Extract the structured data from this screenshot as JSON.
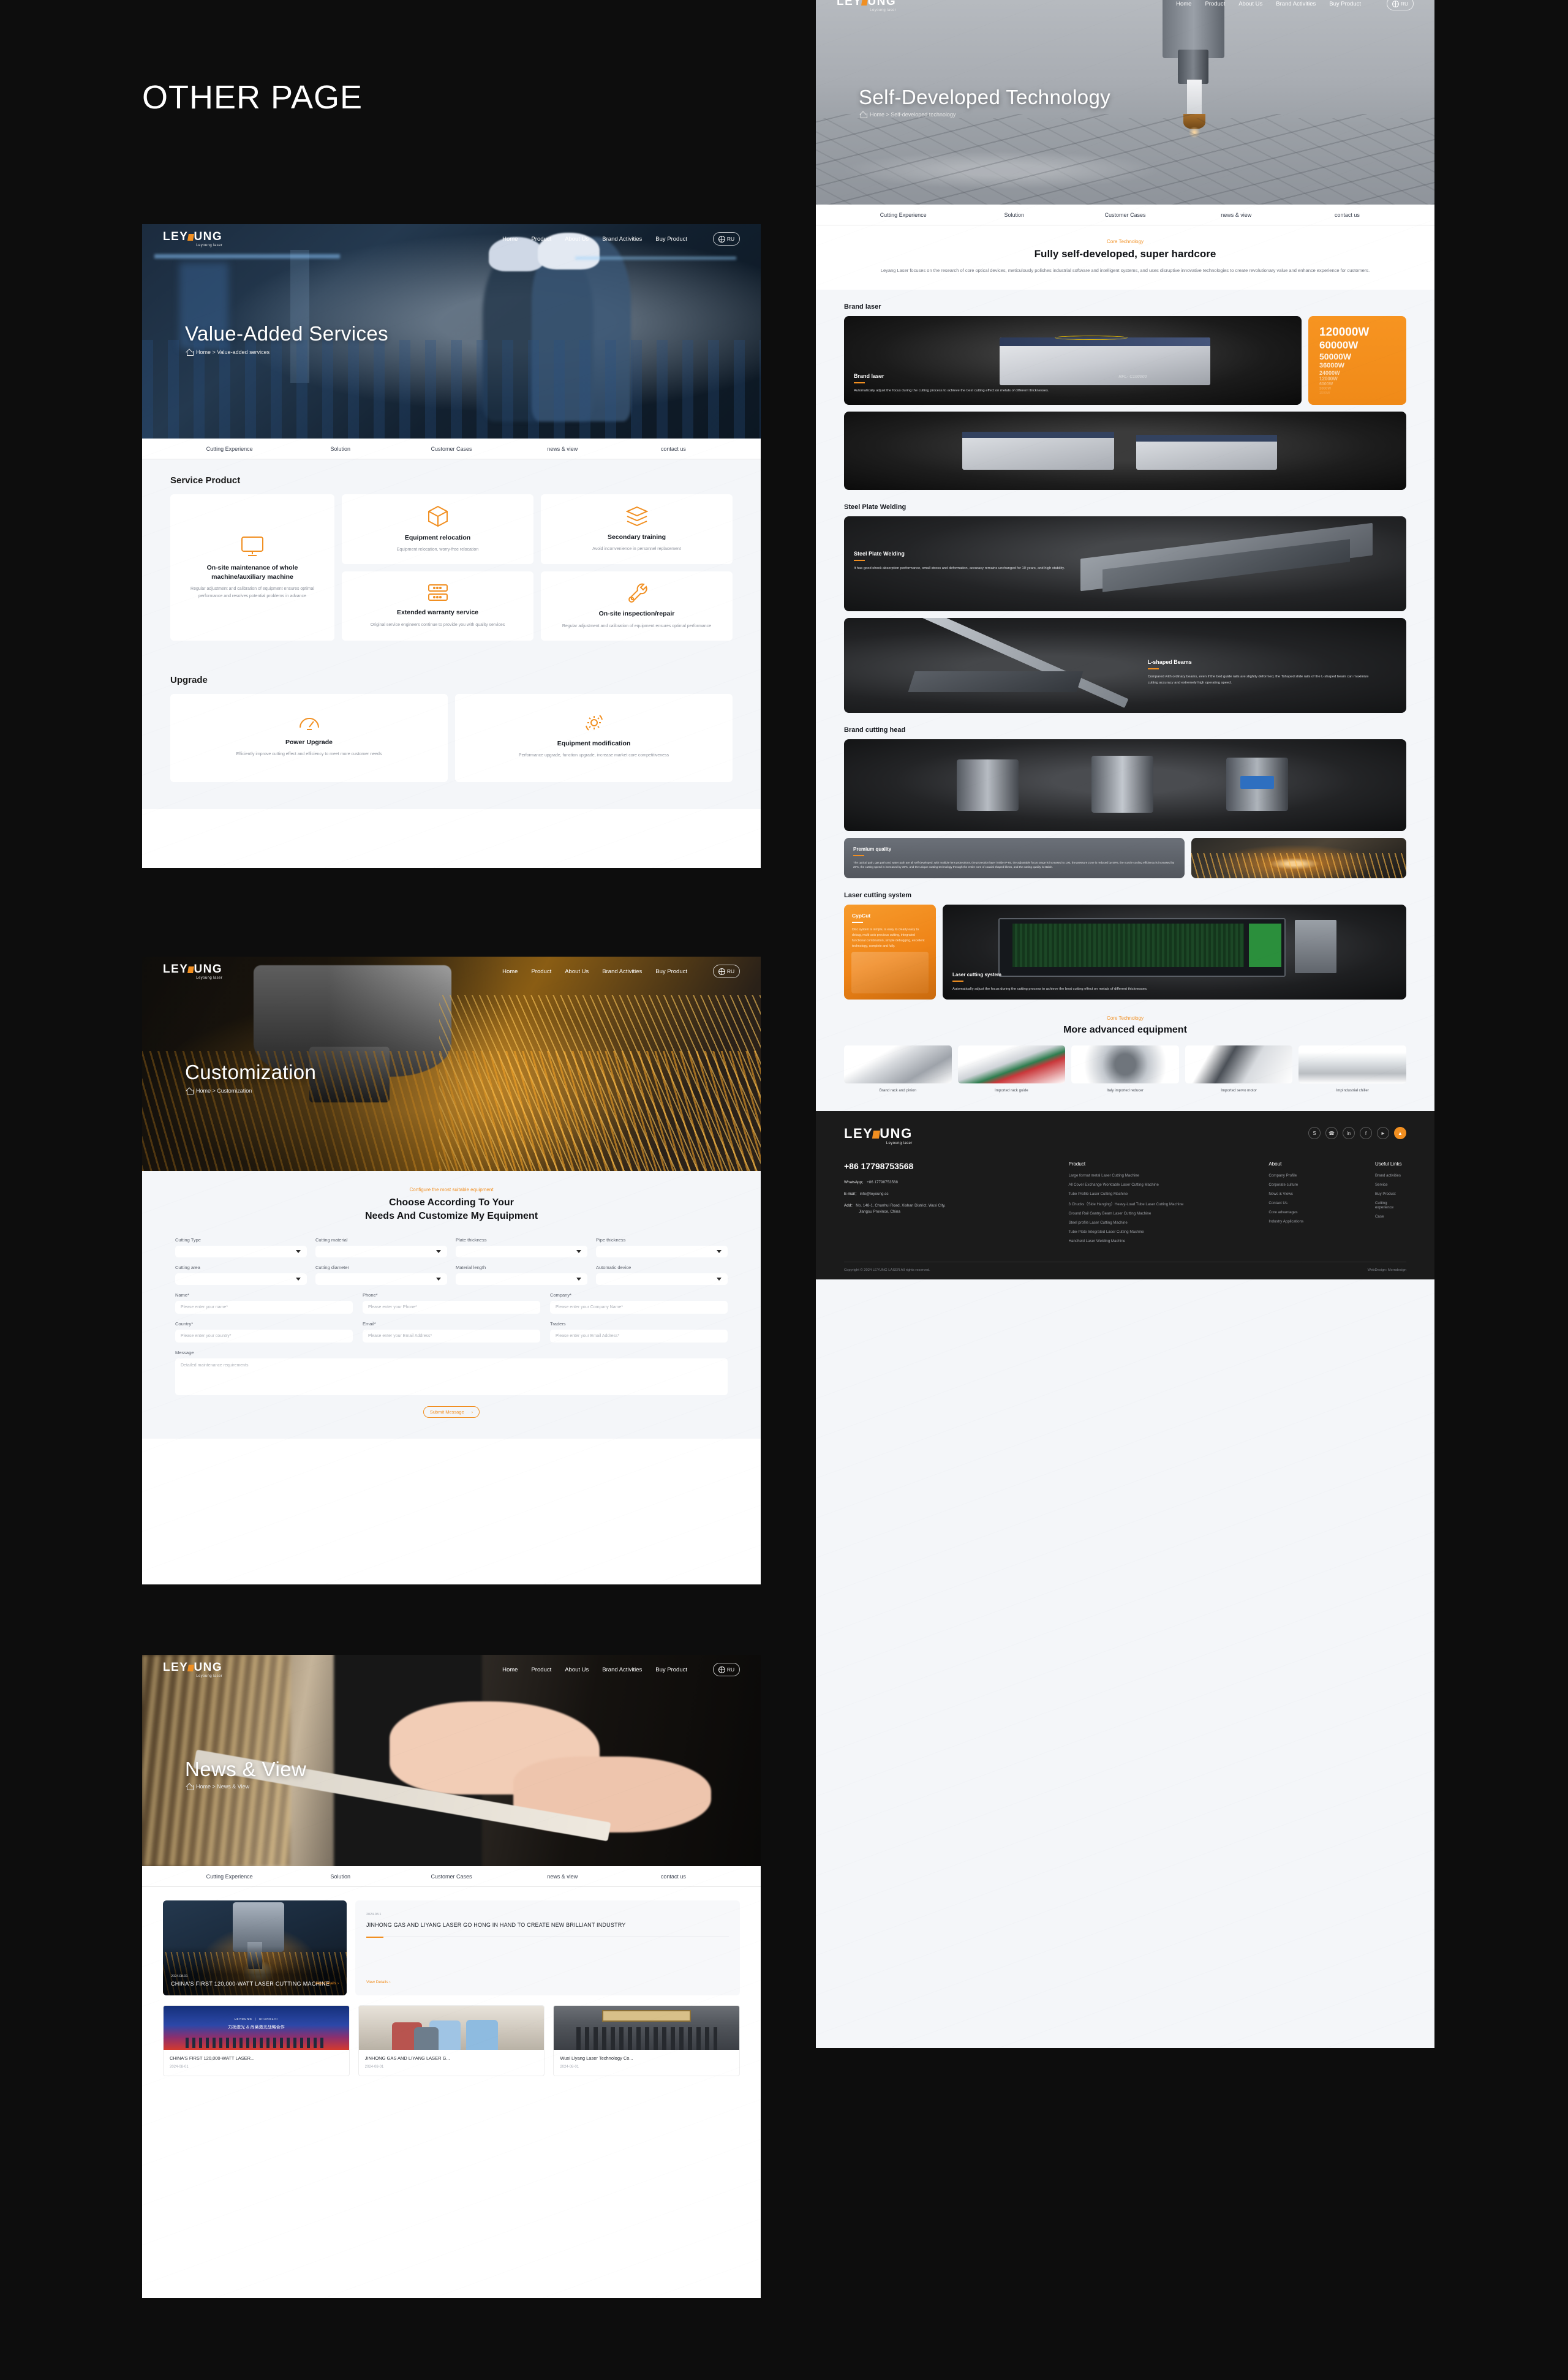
{
  "board": {
    "title": "OTHER PAGE"
  },
  "brand": {
    "name": "LEYOUNG",
    "tagline": "Leyoung laser",
    "accent": "#f18f21"
  },
  "nav": {
    "links": [
      "Home",
      "Product",
      "About Us",
      "Brand Activities",
      "Buy Product"
    ],
    "lang": "RU"
  },
  "subnav": [
    "Cutting Experience",
    "Solution",
    "Customer Cases",
    "news & view",
    "contact us"
  ],
  "pages": {
    "value_added": {
      "hero_title": "Value-Added Services",
      "breadcrumb": "Home > Value-added services",
      "service_section_title": "Service Product",
      "service_main": {
        "icon": "monitor-icon",
        "title": "On-site maintenance of whole machine/auxiliary machine",
        "desc": "Regular adjustment and calibration of equipment ensures optimal performance and resolves potential problems in advance"
      },
      "service_cards": [
        {
          "icon": "box-icon",
          "title": "Equipment relocation",
          "desc": "Equipment relocation, worry-free relocation"
        },
        {
          "icon": "layers-icon",
          "title": "Secondary training",
          "desc": "Avoid inconvenience in personnel replacement"
        },
        {
          "icon": "server-icon",
          "title": "Extended warranty service",
          "desc": "Original service engineers continue to provide you with quality services"
        },
        {
          "icon": "wrench-icon",
          "title": "On-site inspection/repair",
          "desc": "Regular adjustment and calibration of equipment ensures optimal performance"
        }
      ],
      "upgrade_section_title": "Upgrade",
      "upgrade_cards": [
        {
          "icon": "gauge-icon",
          "title": "Power Upgrade",
          "desc": "Efficiently improve cutting effect and efficiency to meet more customer needs"
        },
        {
          "icon": "gear-refresh-icon",
          "title": "Equipment modification",
          "desc": "Performance upgrade, function upgrade, increase market core competitiveness"
        }
      ]
    },
    "customization": {
      "hero_title": "Customization",
      "breadcrumb": "Home > Customization",
      "eyebrow": "Configure the most suitable equipment",
      "heading_line1": "Choose According To Your",
      "heading_line2": "Needs And Customize My Equipment",
      "selects": [
        {
          "label": "Cutting Type",
          "value": ""
        },
        {
          "label": "Cutting material",
          "value": ""
        },
        {
          "label": "Plate thickness",
          "value": ""
        },
        {
          "label": "Pipe thickness",
          "value": ""
        },
        {
          "label": "Cutting area",
          "value": ""
        },
        {
          "label": "Cutting diameter",
          "value": ""
        },
        {
          "label": "Material length",
          "value": ""
        },
        {
          "label": "Automatic device",
          "value": ""
        }
      ],
      "inputs": [
        {
          "label": "Name*",
          "placeholder": "Please enter your name*"
        },
        {
          "label": "Phone*",
          "placeholder": "Please enter your Phone*"
        },
        {
          "label": "Company*",
          "placeholder": "Please enter your Company Name*"
        },
        {
          "label": "Country*",
          "placeholder": "Please enter your country*"
        },
        {
          "label": "Email*",
          "placeholder": "Please enter your Email Address*"
        },
        {
          "label": "Traders",
          "placeholder": "Please enter your Email Address*"
        }
      ],
      "message_label": "Message",
      "message_placeholder": "Detailed maintenance requirements",
      "submit_label": "Submit Message"
    },
    "news": {
      "hero_title": "News & View",
      "breadcrumb": "Home > News & View",
      "featured": {
        "date": "2024.08.01",
        "title": "CHINA'S FIRST 120,000-WATT LASER CUTTING MACHINE",
        "view_details": "View Details"
      },
      "side": {
        "date": "2024.08.1",
        "title": "JINHONG GAS AND LIYANG LASER GO HONG IN HAND TO CREATE NEW BRILLIANT INDUSTRY",
        "view_details": "View Details"
      },
      "cards": [
        {
          "title": "CHINA'S FIRST 120,000-WATT LASER...",
          "date": "2024-08-01"
        },
        {
          "title": "JINHONG GAS AND LIYANG LASER G...",
          "date": "2024-08-01"
        },
        {
          "title": "Wuxi Liyang Laser Technology Co...",
          "date": "2024-08-01"
        }
      ]
    },
    "tech": {
      "hero_title": "Self-Developed Technology",
      "breadcrumb": "Home > Self-developed technology",
      "eyebrow": "Core Technology",
      "heading": "Fully self-developed, super hardcore",
      "paragraph": "Leyang Laser focuses on the research of core optical devices, meticulously polishes industrial software and intelligent systems, and uses disruptive innovative technologies to create revolutionary value and enhance experience for customers.",
      "brand_laser": {
        "section_title": "Brand laser",
        "card_title": "Brand laser",
        "card_desc": "Automatically adjust the focus during the cutting process to achieve the best cutting effect on metals of different thicknesses.",
        "powers": [
          "120000W",
          "60000W",
          "50000W",
          "36000W",
          "24000W",
          "12000W",
          "6000W",
          "3000W",
          "1500W"
        ]
      },
      "steel_plate": {
        "section_title": "Steel Plate Welding",
        "cards": [
          {
            "title": "Steel Plate Welding",
            "desc": "It has good shock absorption performance, small stress and deformation, accuracy remains unchanged for 10 years, and high stability."
          },
          {
            "title": "L-shaped Beams",
            "desc": "Compared with ordinary beams, even if the bed guide rails are slightly deformed, the Tshaped slide rails of the L-shaped beam can maximize cutting accuracy and extremely high operating speed."
          }
        ]
      },
      "cutting_head": {
        "section_title": "Brand cutting head",
        "premium_title": "Premium quality",
        "premium_desc": "The optical path, gas path and water path are all self-developed, with multiple lens protections, the protection layer inside IP-65, the adjustable focus range is increased to 100, the pressure zone is reduced by 50%, the nozzle cooling efficiency is increased by 20%, the cutting speed is increased by 30%, and the unique coating technology through the entire core of coaxial shaped blows, and the cutting quality is stable."
      },
      "cutting_system": {
        "section_title": "Laser cutting system",
        "cypcut_title": "CypCut",
        "cypcut_desc": "Disc system is simple, is easy to clearly easy to debug, multi-axis precious cutting, integrated functional combination, simple debugging, excellent technology, complete and fully.",
        "card_title": "Laser cutting system",
        "card_desc": "Automatically adjust the focus during the cutting process to achieve the best cutting effect on metals of different thicknesses."
      },
      "advanced": {
        "eyebrow": "Core Technology",
        "heading": "More advanced equipment",
        "items": [
          "Brand rack and pinion",
          "Imported rack guide",
          "Italy imported reducer",
          "Imported servo motor",
          "ImpIndustrial chiller"
        ]
      }
    }
  },
  "footer": {
    "phone": "+86 17798753568",
    "whatsapp_label": "WhatsApp：",
    "whatsapp": "+86 17798753568",
    "email_label": "E-mail：",
    "email": "info@leyoung.cc",
    "address_label": "Add：",
    "address_line1": "No. 148-1, Chunhui Road, Xishan District, Wuxi City,",
    "address_line2": "Jiangsu Province, China",
    "socials": [
      "skype-icon",
      "phone-icon",
      "linkedin-icon",
      "facebook-icon",
      "youtube-icon",
      "back-to-top-icon"
    ],
    "columns": [
      {
        "title": "Product",
        "links": [
          "Large format metal Laser Cutting Machine",
          "All Cover Exchange Worktable Laser Cutting Machine",
          "Tube Profile Laser Cutting Machine",
          "3 Chucks（Side Hanging）Heavy-Load Tube Laser Cutting Machine",
          "Ground Rail Gantry Beam Laser Cutting Machine",
          "Steel profile Laser Cutting Machine",
          "Tube-Plate Integrated Laser Cutting Machine",
          "Handheld Laser Welding Machine"
        ]
      },
      {
        "title": "About",
        "links": [
          "Company Profile",
          "Corporate culture",
          "News & Views",
          "Contact Us",
          "Core advantages",
          "Industry Applications"
        ]
      },
      {
        "title": "Useful Links",
        "links": [
          "Brand activities",
          "Service",
          "Buy Product",
          "Cutting experience",
          "Case"
        ]
      }
    ],
    "copyright": "Copyright © 2024 LEYUNG LASER All rights reserved.",
    "webdesign": "WebDesign: Morndesign"
  }
}
